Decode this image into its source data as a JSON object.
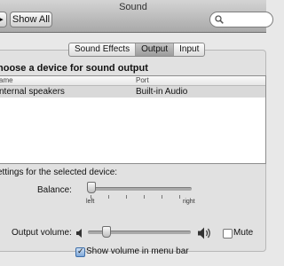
{
  "window": {
    "title": "Sound"
  },
  "toolbar": {
    "show_all_label": "Show All"
  },
  "tabs": [
    {
      "label": "Sound Effects",
      "active": false
    },
    {
      "label": "Output",
      "active": true
    },
    {
      "label": "Input",
      "active": false
    }
  ],
  "output": {
    "heading": "hoose a device for sound output",
    "columns": {
      "name": "ame",
      "port": "Port"
    },
    "devices": [
      {
        "name": "nternal speakers",
        "port": "Built-in Audio",
        "selected": true
      }
    ],
    "settings_heading": "ettings for the selected device:",
    "balance": {
      "label": "Balance:",
      "left_label": "left",
      "right_label": "right",
      "value": 0.0
    }
  },
  "volume": {
    "label": "Output volume:",
    "level": 0.15,
    "mute_label": "Mute",
    "mute_checked": false,
    "show_in_menu_label": "Show volume in menu bar",
    "show_in_menu_checked": true
  },
  "icons": {
    "search": "search-icon",
    "speaker_low": "speaker-low-icon",
    "speaker_high": "speaker-high-icon",
    "checkmark": "✓"
  }
}
